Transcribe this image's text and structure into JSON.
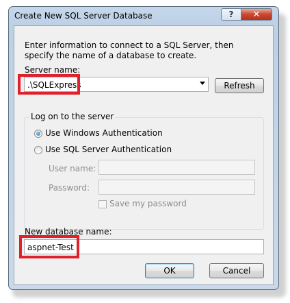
{
  "window": {
    "title": "Create New SQL Server Database",
    "help_label": "?",
    "close_label": "✕"
  },
  "description": "Enter information to connect to a SQL Server, then specify the name of a database to create.",
  "server": {
    "label": "Server name:",
    "value": ".\\SQLExpress",
    "refresh_label": "Refresh"
  },
  "logon": {
    "legend": "Log on to the server",
    "windows_auth_label": "Use Windows Authentication",
    "sql_auth_label": "Use SQL Server Authentication",
    "selected": "windows",
    "username_label": "User name:",
    "username_value": "",
    "password_label": "Password:",
    "password_value": "",
    "save_password_label": "Save my password",
    "save_password_checked": false
  },
  "database": {
    "label": "New database name:",
    "value": "aspnet-Test"
  },
  "buttons": {
    "ok_label": "OK",
    "cancel_label": "Cancel"
  },
  "colors": {
    "highlight": "#e0202a",
    "titlebar": "#c6d7ea",
    "close": "#c7482f"
  }
}
